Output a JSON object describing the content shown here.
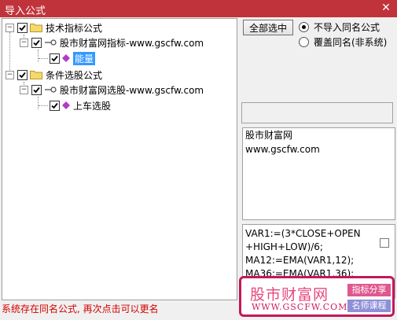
{
  "window": {
    "title": "导入公式",
    "close_glyph": "✕"
  },
  "tree": {
    "group1": {
      "label": "技术指标公式",
      "child": {
        "label": "股市财富网指标-www.gscfw.com",
        "leaf": "能量"
      }
    },
    "group2": {
      "label": "条件选股公式",
      "child": {
        "label": "股市财富网选股-www.gscfw.com",
        "leaf": "上车选股"
      }
    },
    "expander_glyph": "−"
  },
  "controls": {
    "select_all": "全部选中",
    "radio1": "不导入同名公式",
    "radio2": "覆盖同名(非系统)",
    "radio_selected": 1
  },
  "description": {
    "line1": "股市财富网",
    "line2": "www.gscfw.com"
  },
  "code": {
    "lines": [
      "VAR1:=(3*CLOSE+OPEN",
      "+HIGH+LOW)/6;",
      "MA12:=EMA(VAR1,12);",
      "MA36:=EMA(VAR1,36);"
    ]
  },
  "status": "系统存在同名公式, 再次点击可以更名",
  "watermark": {
    "name": "股市财富网",
    "url": "WWW.GSCFW.COM",
    "tag1": "指标分享",
    "tag2": "名师课程"
  },
  "colors": {
    "titlebar": "#c1333a",
    "status": "#d40000",
    "selection": "#3399ff",
    "watermark_border": "#c2185b"
  }
}
